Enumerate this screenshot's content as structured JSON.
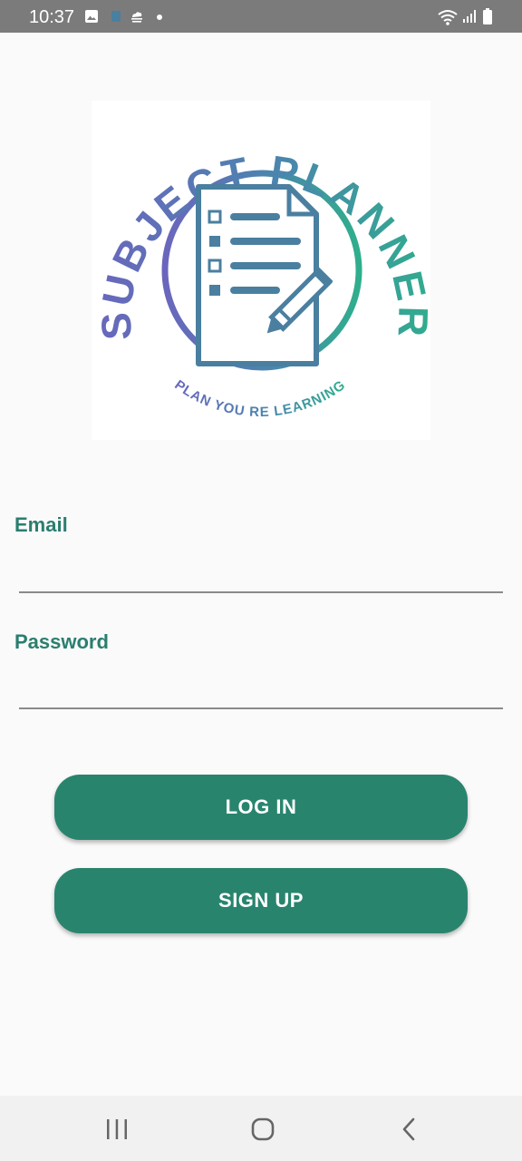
{
  "status_bar": {
    "time": "10:37",
    "icons": [
      "image-icon",
      "app-icon",
      "cloud-icon",
      "dot-icon",
      "wifi-icon",
      "signal-icon",
      "battery-icon"
    ]
  },
  "logo": {
    "title": "SUBJECT PLANNER",
    "tagline": "PLAN YOU RE LEARNING",
    "colors": {
      "purple": "#6a66bd",
      "blue": "#4a86ad",
      "teal": "#2fae8c"
    }
  },
  "form": {
    "email_label": "Email",
    "email_value": "",
    "password_label": "Password",
    "password_value": ""
  },
  "buttons": {
    "login_label": "LOG IN",
    "signup_label": "SIGN UP"
  },
  "theme": {
    "primary": "#29846e",
    "label": "#2b7e6f"
  },
  "nav": {
    "icons": [
      "recent-apps-icon",
      "home-icon",
      "back-icon"
    ]
  }
}
